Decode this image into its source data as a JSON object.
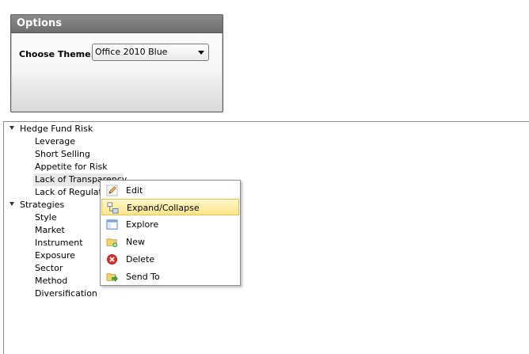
{
  "options": {
    "title": "Options",
    "theme_label": "Choose Theme:",
    "theme_value": "Office 2010 Blue"
  },
  "tree": {
    "groups": [
      {
        "label": "Hedge Fund Risk",
        "children": [
          "Leverage",
          "Short Selling",
          "Appetite for Risk",
          "Lack of Transparency",
          "Lack of Regulation"
        ]
      },
      {
        "label": "Strategies",
        "children": [
          "Style",
          "Market",
          "Instrument",
          "Exposure",
          "Sector",
          "Method",
          "Diversification"
        ]
      }
    ]
  },
  "context_menu": {
    "items": [
      {
        "label": "Edit",
        "icon": "pencil-icon"
      },
      {
        "label": "Expand/Collapse",
        "icon": "expand-collapse-icon",
        "highlighted": true
      },
      {
        "label": "Explore",
        "icon": "explore-icon"
      },
      {
        "label": "New",
        "icon": "new-folder-icon"
      },
      {
        "label": "Delete",
        "icon": "delete-icon"
      },
      {
        "label": "Send To",
        "icon": "send-to-icon"
      }
    ]
  },
  "colors": {
    "header": "#7d7d7d",
    "highlight": "#ffe68a",
    "highlight_border": "#e3c154"
  }
}
